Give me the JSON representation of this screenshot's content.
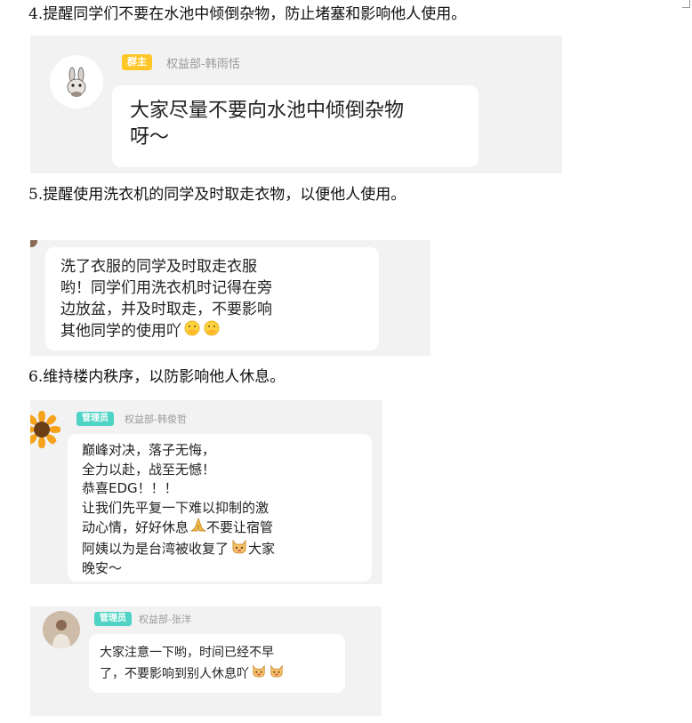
{
  "headings": {
    "h4": "4.提醒同学们不要在水池中倾倒杂物，防止堵塞和影响他人使用。",
    "h5": "5.提醒使用洗衣机的同学及时取走衣物，以便他人使用。",
    "h6": "6.维持楼内秩序，以防影响他人休息。"
  },
  "chat1": {
    "badge": "群主",
    "badge_color": "#ffc629",
    "sender": "权益部-韩雨恬",
    "lines": [
      "大家尽量不要向水池中倾倒杂物",
      "呀～"
    ]
  },
  "chat2": {
    "lines": [
      "洗了衣服的同学及时取走衣服",
      "哟！同学们用洗衣机时记得在旁",
      "边放盆，并及时取走，不要影响",
      "其他同学的使用吖"
    ],
    "emojis": [
      "hand-over-mouth-emoji",
      "hand-over-mouth-emoji"
    ]
  },
  "chat3": {
    "badge": "管理员",
    "badge_color": "#4fd3c4",
    "sender": "权益部-韩俊哲",
    "lines": [
      "巅峰对决，落子无悔，",
      "全力以赴，战至无憾！",
      "恭喜EDG！！！",
      "让我们先平复一下难以抑制的激",
      "动心情，好好休息",
      "不要让宿管",
      "阿姨以为是台湾被收复了",
      "大家",
      "晚安～"
    ]
  },
  "chat4": {
    "badge": "管理员",
    "badge_color": "#4fd3c4",
    "sender": "权益部-张洋",
    "lines": [
      "大家注意一下哟，时间已经不早",
      "了，不要影响到别人休息吖"
    ]
  },
  "colors": {
    "chat_bg": "#f2f2f2",
    "bubble_bg": "#ffffff"
  },
  "icons": [
    "rabbit-avatar",
    "sunflower-avatar",
    "person-avatar",
    "folded-hands-emoji",
    "cat-face-emoji"
  ]
}
